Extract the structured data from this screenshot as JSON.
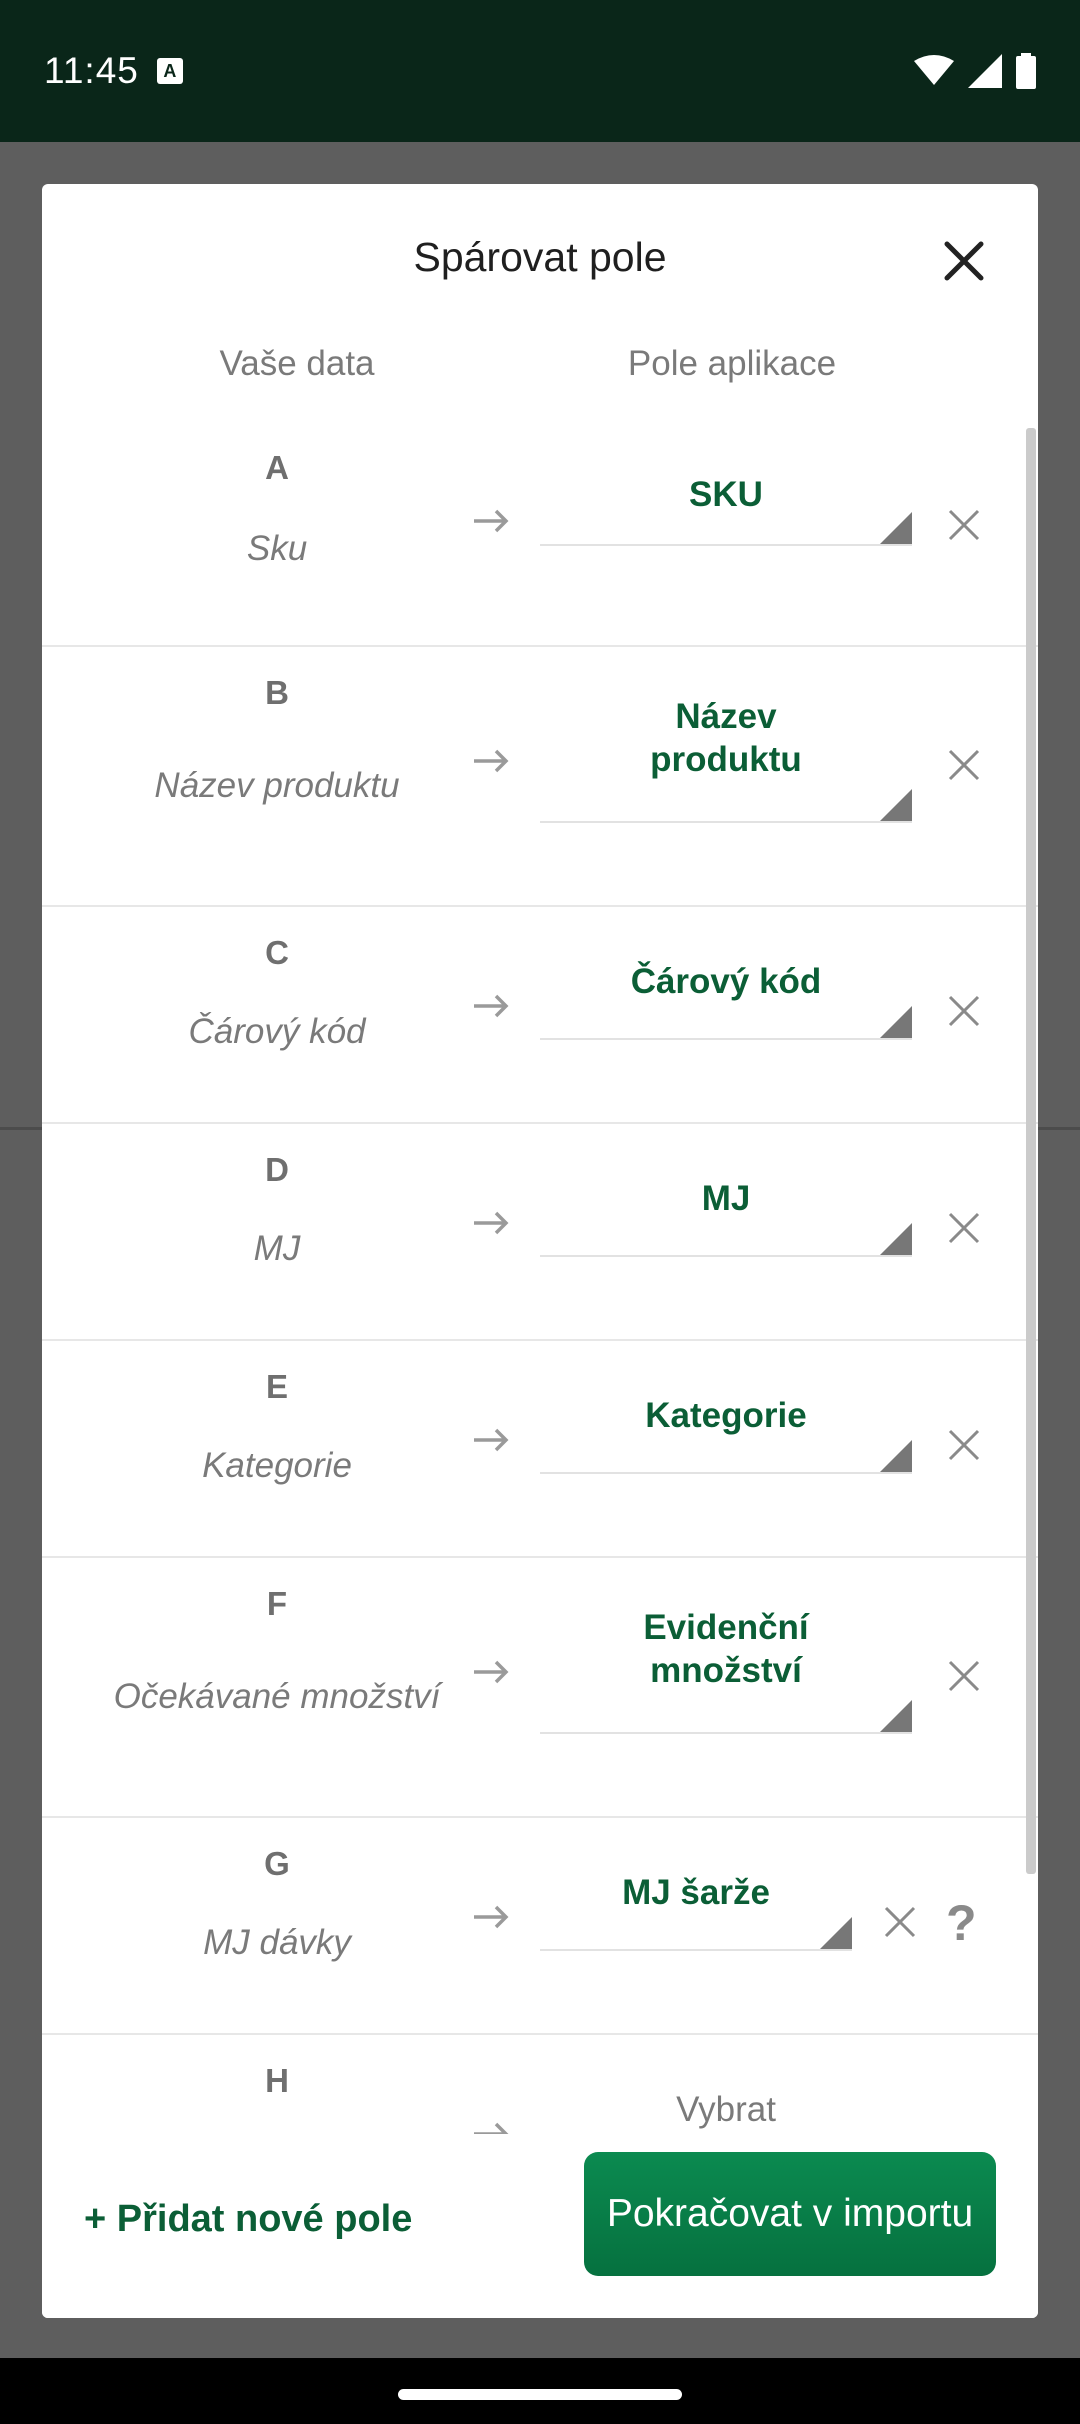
{
  "status_bar": {
    "time": "11:45",
    "notification_letter": "A"
  },
  "dialog": {
    "title": "Spárovat pole",
    "columns": {
      "your_data": "Vaše data",
      "app_fields": "Pole aplikace"
    },
    "rows": [
      {
        "letter": "A",
        "source": "Sku",
        "target_lines": [
          "SKU"
        ]
      },
      {
        "letter": "B",
        "source": "Název produktu",
        "target_lines": [
          "Název",
          "produktu"
        ]
      },
      {
        "letter": "C",
        "source": "Čárový kód",
        "target_lines": [
          "Čárový kód"
        ]
      },
      {
        "letter": "D",
        "source": "MJ",
        "target_lines": [
          "MJ"
        ]
      },
      {
        "letter": "E",
        "source": "Kategorie",
        "target_lines": [
          "Kategorie"
        ]
      },
      {
        "letter": "F",
        "source": "Očekávané množství",
        "target_lines": [
          "Evidenční",
          "množství"
        ]
      },
      {
        "letter": "G",
        "source": "MJ dávky",
        "target_lines": [
          "MJ šarže"
        ],
        "help": "?"
      },
      {
        "letter": "H",
        "source": "",
        "target_lines": [
          "Vybrat"
        ]
      }
    ],
    "add_field_label": "+ Přidat nové pole",
    "continue_label": "Pokračovat v importu"
  },
  "colors": {
    "accent": "#0b5e36",
    "button": "#06713f",
    "status_bar": "#0a2619"
  }
}
